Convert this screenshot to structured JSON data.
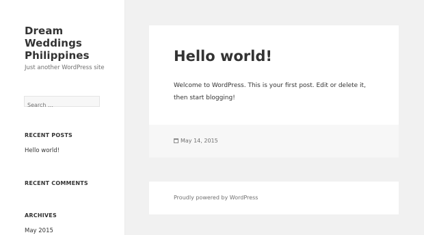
{
  "site": {
    "title": "Dream Weddings Philippines",
    "description": "Just another WordPress site"
  },
  "search": {
    "placeholder": "Search …"
  },
  "sidebar": {
    "recent_posts_title": "RECENT POSTS",
    "recent_posts": [
      "Hello world!"
    ],
    "recent_comments_title": "RECENT COMMENTS",
    "archives_title": "ARCHIVES",
    "archives": [
      "May 2015"
    ]
  },
  "post": {
    "title": "Hello world!",
    "body": "Welcome to WordPress. This is your first post. Edit or delete it, then start blogging!",
    "date": "May 14, 2015"
  },
  "footer": {
    "credit": "Proudly powered by WordPress"
  }
}
